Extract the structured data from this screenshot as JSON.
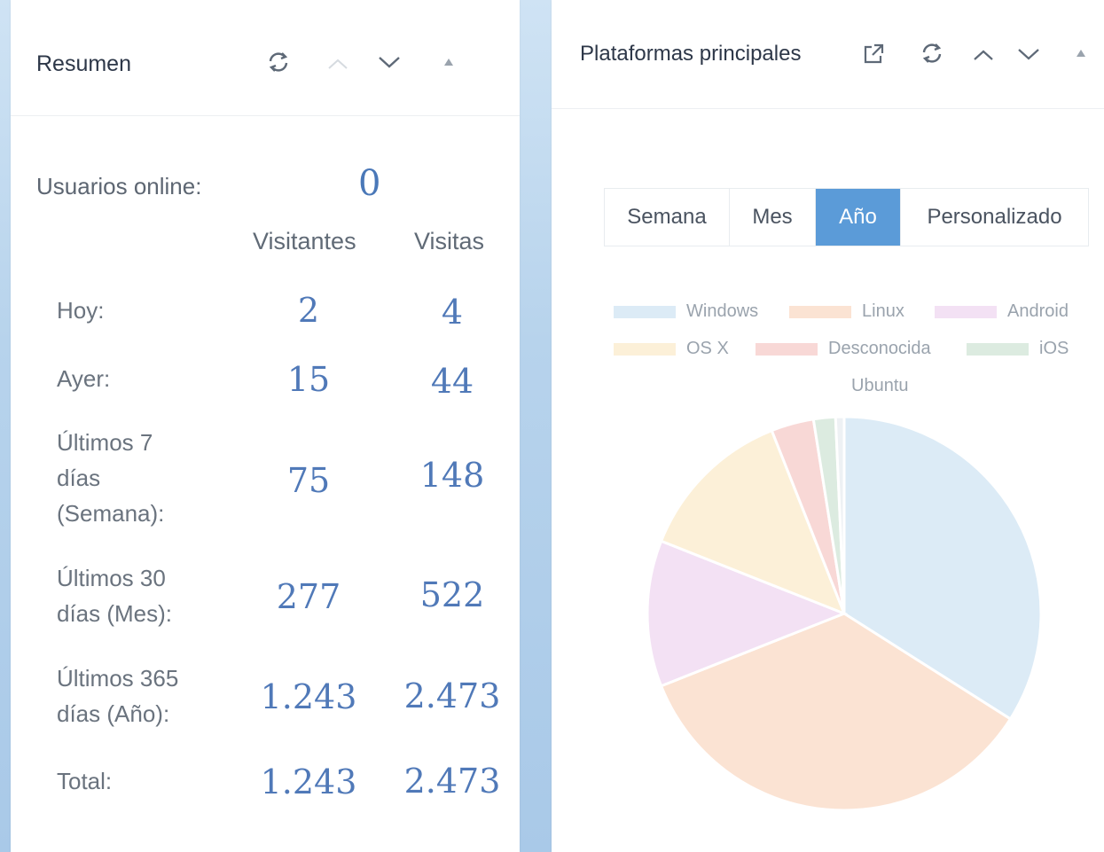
{
  "resumen": {
    "title": "Resumen",
    "online_label": "Usuarios online:",
    "online_value": "0",
    "col_visitors": "Visitantes",
    "col_visits": "Visitas",
    "rows": [
      {
        "label": "Hoy:",
        "visitors": "2",
        "visits": "4"
      },
      {
        "label": "Ayer:",
        "visitors": "15",
        "visits": "44"
      },
      {
        "label_lines": [
          "Últimos 7",
          "días",
          "(Semana):"
        ],
        "visitors": "75",
        "visits": "148"
      },
      {
        "label_lines": [
          "Últimos 30",
          "días (Mes):"
        ],
        "visitors": "277",
        "visits": "522"
      },
      {
        "label_lines": [
          "Últimos 365",
          "días (Año):"
        ],
        "visitors": "1.243",
        "visits": "2.473"
      },
      {
        "label": "Total:",
        "visitors": "1.243",
        "visits": "2.473"
      }
    ]
  },
  "plataformas": {
    "title": "Plataformas principales",
    "tabs": [
      {
        "label": "Semana",
        "active": false
      },
      {
        "label": "Mes",
        "active": false
      },
      {
        "label": "Año",
        "active": true
      },
      {
        "label": "Personalizado",
        "active": false
      }
    ]
  },
  "icons": {
    "external": "external-link-icon",
    "refresh": "refresh-icon",
    "up": "chevron-up-icon",
    "down": "chevron-down-icon",
    "collapse": "triangle-up-icon"
  },
  "colors": {
    "accent": "#5b9bd8",
    "value_blue": "#5079b8"
  },
  "chart_data": {
    "type": "pie",
    "legend_placement": "top",
    "slices": [
      {
        "name": "Windows",
        "value": 34,
        "color": "#dcebf6"
      },
      {
        "name": "Linux",
        "value": 35,
        "color": "#fbe3d3"
      },
      {
        "name": "Android",
        "value": 12,
        "color": "#f3e1f4"
      },
      {
        "name": "OS X",
        "value": 13,
        "color": "#fcf0d8"
      },
      {
        "name": "Desconocida",
        "value": 3.5,
        "color": "#f8d8d6"
      },
      {
        "name": "iOS",
        "value": 1.8,
        "color": "#dcebe0"
      },
      {
        "name": "Ubuntu",
        "value": 0.7,
        "color": "#eef1f4"
      }
    ]
  }
}
